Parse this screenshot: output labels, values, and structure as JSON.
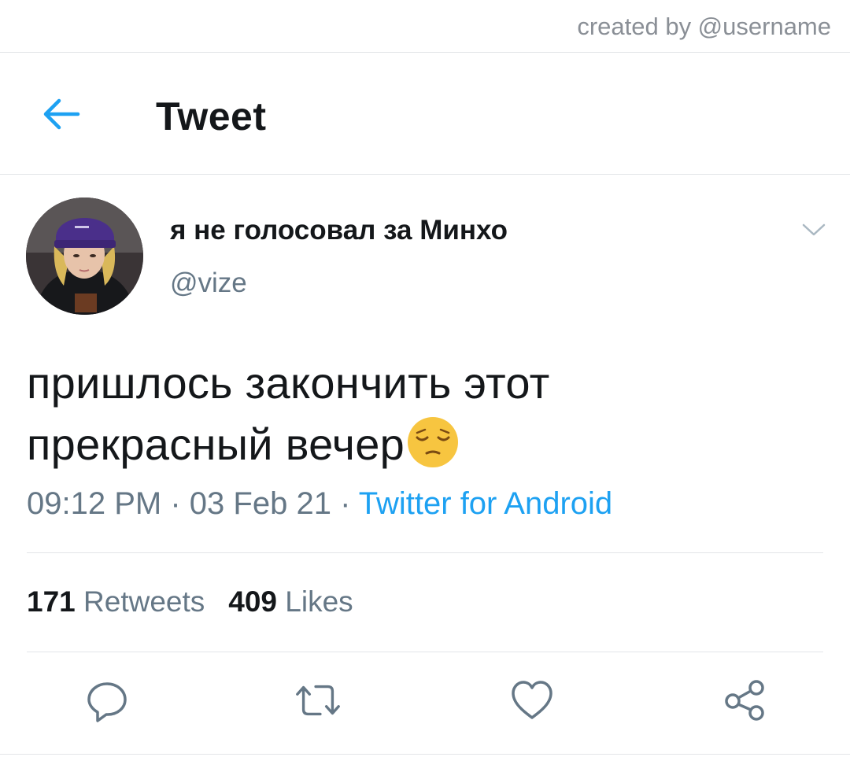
{
  "watermark": {
    "text": "created by @username"
  },
  "header": {
    "title": "Tweet",
    "back_icon": "arrow-left-icon",
    "accent": "#1da1f2"
  },
  "tweet": {
    "author": {
      "display_name": "я не голосовал за Минхо",
      "handle": "@vize",
      "avatar_icon": "avatar-photo"
    },
    "text_lines": [
      "пришлось закончить этот",
      "прекрасный вечер"
    ],
    "emoji": "pensive-face-emoji",
    "time": "09:12 PM",
    "separator": "·",
    "date": "03 Feb 21",
    "source": "Twitter for Android"
  },
  "stats": {
    "retweets_count": "171",
    "retweets_label": "Retweets",
    "likes_count": "409",
    "likes_label": "Likes"
  },
  "actions": {
    "reply_icon": "reply-icon",
    "retweet_icon": "retweet-icon",
    "like_icon": "heart-icon",
    "share_icon": "share-icon"
  },
  "colors": {
    "text": "#14171a",
    "secondary": "#657786",
    "link": "#1da1f2",
    "border": "#e3e5e8"
  }
}
